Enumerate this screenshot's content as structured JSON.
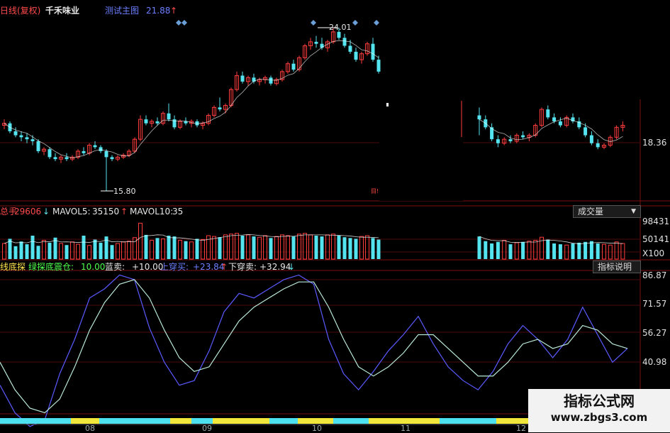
{
  "header": {
    "title_prefix": "日线(复权)",
    "stock_name": "千禾味业",
    "main_indicator": "测试主图",
    "main_value": "21.88",
    "up_arrow": "↑"
  },
  "price_panel": {
    "high_label": "24.01",
    "low_label": "15.80",
    "y_labels": [
      "18.36"
    ]
  },
  "volume_panel": {
    "vol_label": "总手",
    "vol_value": "29606",
    "vol_arrow": "↓",
    "mavol5_label": "MAVOL5:",
    "mavol5_value": "35150",
    "mavol5_arrow": "↑",
    "mavol10_label": "MAVOL10:",
    "mavol10_value": "35",
    "dropdown_label": "成交量",
    "y_labels": [
      "98431",
      "50141",
      "X100"
    ]
  },
  "indicator_panel": {
    "name": "线底探",
    "sub_name": "绿探底震仓:",
    "sub_value": "10.00",
    "blue_label": "蓝卖:",
    "blue_value": "+10.00",
    "cross_up_label": "上穿买:",
    "cross_up_value": "+23.84",
    "cross_up_arrow": "↑",
    "cross_down_label": "下穿卖:",
    "cross_down_value": "+32.94",
    "cross_down_arrow": "↓",
    "help_button": "指标说明",
    "y_labels": [
      "86.87",
      "71.57",
      "56.27",
      "40.98"
    ]
  },
  "x_labels": [
    "08",
    "09",
    "10",
    "11",
    "12"
  ],
  "watermark": {
    "line1": "指标公式网",
    "line2": "www.zbgs3.com"
  },
  "colors": {
    "up": "#ff3c3c",
    "down": "#54e4ef",
    "ma": "#ffffff",
    "line1": "#5a5aff",
    "line2": "#b8e8d8"
  },
  "chart_data": {
    "type": "candlestick+bar+line",
    "candles": [
      [
        19.1,
        19.4,
        18.9,
        19.2
      ],
      [
        19.2,
        19.3,
        18.7,
        18.8
      ],
      [
        18.8,
        19.0,
        18.5,
        18.6
      ],
      [
        18.6,
        18.8,
        18.3,
        18.5
      ],
      [
        18.5,
        18.7,
        18.2,
        18.4
      ],
      [
        18.4,
        18.6,
        18.1,
        18.3
      ],
      [
        18.3,
        18.4,
        17.7,
        17.8
      ],
      [
        17.8,
        18.0,
        17.6,
        17.9
      ],
      [
        17.9,
        18.0,
        17.4,
        17.5
      ],
      [
        17.5,
        17.7,
        17.3,
        17.4
      ],
      [
        17.4,
        17.6,
        17.2,
        17.5
      ],
      [
        17.5,
        17.7,
        17.3,
        17.4
      ],
      [
        17.4,
        17.6,
        17.3,
        17.5
      ],
      [
        17.5,
        17.9,
        17.4,
        17.8
      ],
      [
        17.8,
        18.0,
        17.6,
        17.7
      ],
      [
        17.7,
        18.2,
        17.6,
        18.1
      ],
      [
        18.1,
        18.3,
        17.9,
        18.0
      ],
      [
        18.0,
        18.1,
        17.7,
        17.8
      ],
      [
        17.8,
        17.9,
        15.8,
        17.5
      ],
      [
        17.5,
        17.6,
        17.3,
        17.4
      ],
      [
        17.4,
        17.6,
        17.3,
        17.5
      ],
      [
        17.5,
        17.7,
        17.4,
        17.6
      ],
      [
        17.6,
        17.9,
        17.5,
        17.8
      ],
      [
        17.8,
        18.5,
        17.7,
        18.4
      ],
      [
        18.4,
        19.6,
        18.3,
        19.4
      ],
      [
        19.4,
        19.6,
        19.1,
        19.2
      ],
      [
        19.2,
        19.4,
        19.0,
        19.3
      ],
      [
        19.3,
        19.5,
        19.1,
        19.2
      ],
      [
        19.2,
        19.8,
        19.1,
        19.7
      ],
      [
        19.7,
        20.2,
        19.3,
        19.4
      ],
      [
        19.4,
        19.6,
        18.9,
        19.0
      ],
      [
        19.0,
        19.4,
        18.9,
        19.3
      ],
      [
        19.3,
        19.5,
        19.1,
        19.2
      ],
      [
        19.2,
        19.4,
        19.0,
        19.3
      ],
      [
        19.3,
        19.4,
        19.0,
        19.1
      ],
      [
        19.1,
        19.3,
        18.9,
        19.2
      ],
      [
        19.2,
        19.7,
        19.1,
        19.6
      ],
      [
        19.6,
        20.1,
        19.5,
        20.0
      ],
      [
        20.0,
        20.5,
        19.8,
        19.9
      ],
      [
        19.9,
        20.2,
        19.7,
        20.1
      ],
      [
        20.1,
        21.0,
        20.0,
        20.9
      ],
      [
        20.9,
        21.8,
        20.8,
        21.6
      ],
      [
        21.6,
        21.8,
        21.2,
        21.3
      ],
      [
        21.3,
        21.6,
        21.1,
        21.5
      ],
      [
        21.5,
        21.7,
        21.2,
        21.3
      ],
      [
        21.3,
        21.5,
        21.1,
        21.4
      ],
      [
        21.4,
        21.6,
        21.2,
        21.5
      ],
      [
        21.5,
        21.6,
        21.1,
        21.2
      ],
      [
        21.2,
        21.5,
        21.1,
        21.4
      ],
      [
        21.4,
        21.9,
        21.3,
        21.8
      ],
      [
        21.8,
        22.3,
        21.7,
        22.2
      ],
      [
        22.2,
        22.4,
        21.8,
        21.9
      ],
      [
        21.9,
        22.6,
        21.8,
        22.5
      ],
      [
        22.5,
        23.2,
        22.4,
        23.1
      ],
      [
        23.1,
        23.5,
        22.9,
        23.3
      ],
      [
        23.3,
        23.6,
        23.0,
        23.2
      ],
      [
        23.2,
        23.5,
        22.9,
        23.0
      ],
      [
        23.0,
        23.4,
        22.8,
        23.3
      ],
      [
        23.3,
        24.0,
        23.2,
        23.8
      ],
      [
        23.8,
        24.01,
        23.4,
        23.5
      ],
      [
        23.5,
        23.7,
        23.0,
        23.1
      ],
      [
        23.1,
        23.4,
        22.7,
        22.8
      ],
      [
        22.8,
        23.0,
        22.3,
        22.4
      ],
      [
        22.4,
        22.8,
        22.2,
        22.7
      ],
      [
        22.7,
        23.3,
        22.6,
        23.2
      ],
      [
        23.2,
        23.5,
        22.3,
        22.4
      ],
      [
        22.4,
        22.6,
        21.7,
        21.8
      ]
    ],
    "candles_right": [
      [
        19.6,
        20.0,
        18.6,
        19.4
      ],
      [
        19.4,
        19.6,
        18.9,
        19.0
      ],
      [
        19.0,
        19.2,
        18.3,
        18.4
      ],
      [
        18.4,
        18.6,
        18.0,
        18.2
      ],
      [
        18.2,
        18.5,
        18.1,
        18.4
      ],
      [
        18.4,
        18.6,
        18.2,
        18.3
      ],
      [
        18.3,
        18.7,
        18.2,
        18.6
      ],
      [
        18.6,
        18.8,
        18.4,
        18.5
      ],
      [
        18.5,
        18.7,
        18.3,
        18.6
      ],
      [
        18.6,
        19.2,
        18.5,
        19.1
      ],
      [
        19.1,
        20.0,
        19.0,
        19.9
      ],
      [
        19.9,
        20.1,
        19.4,
        19.5
      ],
      [
        19.5,
        19.7,
        19.2,
        19.3
      ],
      [
        19.3,
        19.5,
        19.0,
        19.1
      ],
      [
        19.1,
        19.6,
        19.0,
        19.5
      ],
      [
        19.5,
        19.7,
        19.2,
        19.3
      ],
      [
        19.3,
        19.5,
        18.9,
        19.0
      ],
      [
        19.0,
        19.2,
        18.5,
        18.6
      ],
      [
        18.6,
        18.8,
        18.1,
        18.2
      ],
      [
        18.2,
        18.4,
        17.9,
        18.0
      ],
      [
        18.0,
        18.2,
        17.9,
        18.1
      ],
      [
        18.1,
        18.6,
        18.0,
        18.5
      ],
      [
        18.5,
        19.1,
        18.4,
        19.0
      ],
      [
        19.0,
        19.3,
        18.8,
        19.1
      ]
    ],
    "volume_left": [
      40,
      52,
      33,
      45,
      38,
      60,
      34,
      48,
      42,
      55,
      40,
      36,
      44,
      38,
      60,
      35,
      50,
      42,
      58,
      36,
      40,
      44,
      46,
      55,
      92,
      62,
      48,
      54,
      52,
      60,
      58,
      48,
      46,
      44,
      52,
      50,
      60,
      58,
      56,
      62,
      64,
      66,
      60,
      62,
      58,
      56,
      60,
      54,
      58,
      62,
      60,
      58,
      64,
      66,
      62,
      60,
      58,
      62,
      64,
      60,
      56,
      54,
      52,
      58,
      60,
      54,
      50
    ],
    "volume_right": [
      58,
      46,
      40,
      44,
      48,
      38,
      42,
      44,
      46,
      48,
      56,
      50,
      40,
      38,
      36,
      40,
      42,
      44,
      46,
      40,
      38,
      36,
      44,
      40
    ],
    "k_series": [
      40,
      28,
      22,
      25,
      45,
      60,
      78,
      82,
      88,
      86,
      65,
      50,
      40,
      42,
      55,
      72,
      80,
      78,
      82,
      86,
      88,
      84,
      60,
      45,
      38,
      46,
      55,
      62,
      70,
      58,
      48,
      42,
      38,
      46,
      58,
      66,
      60,
      52,
      60,
      74,
      62,
      50,
      56
    ],
    "d_series": [
      50,
      38,
      30,
      28,
      34,
      48,
      64,
      76,
      84,
      86,
      78,
      64,
      52,
      46,
      48,
      58,
      68,
      74,
      78,
      82,
      85,
      85,
      74,
      60,
      48,
      44,
      48,
      54,
      62,
      62,
      56,
      50,
      44,
      44,
      50,
      58,
      60,
      56,
      58,
      66,
      64,
      58,
      56
    ],
    "ylim_indicator": [
      30,
      90
    ],
    "xlabel": "",
    "ylabel": ""
  }
}
